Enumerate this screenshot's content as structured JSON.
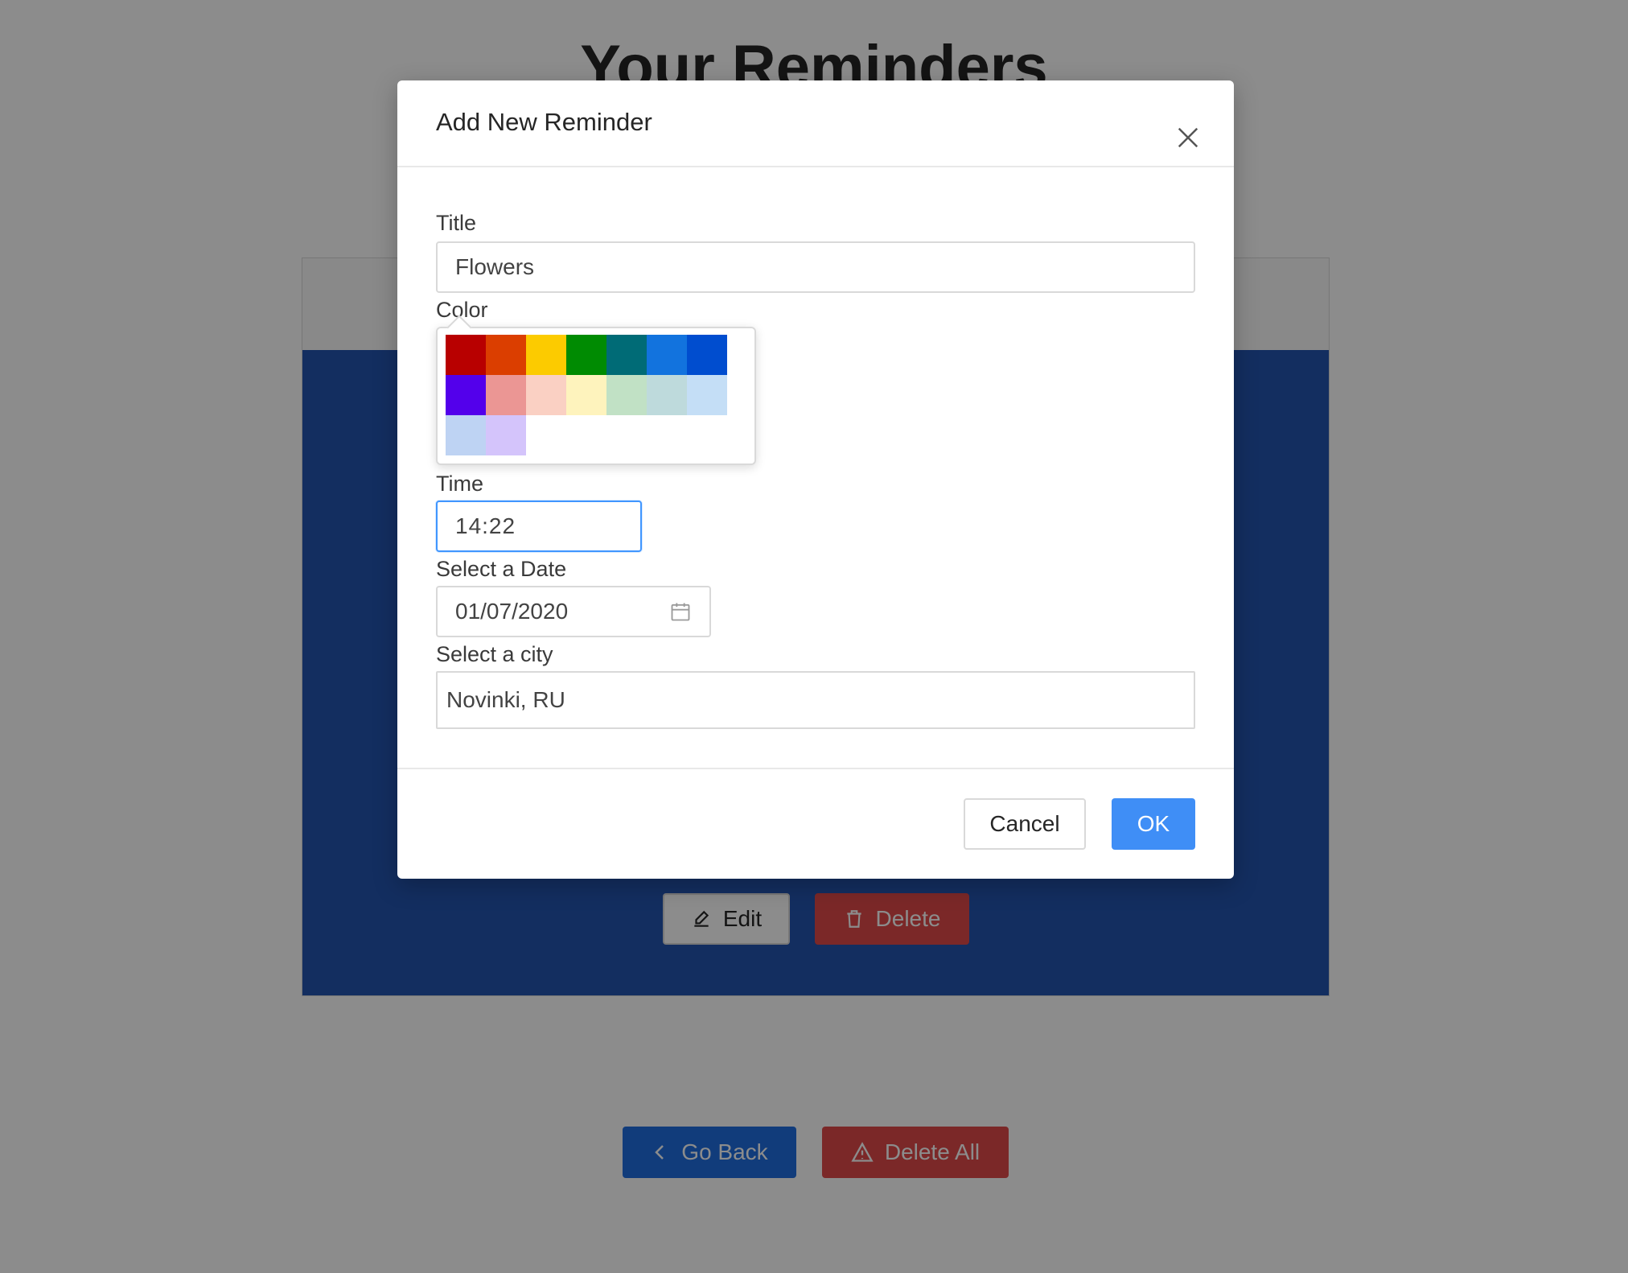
{
  "page": {
    "title": "Your Reminders"
  },
  "reminder_card": {
    "edit_label": "Edit",
    "delete_label": "Delete",
    "color": "#2454b0"
  },
  "actions": {
    "go_back_label": "Go Back",
    "delete_all_label": "Delete All"
  },
  "modal": {
    "title": "Add New Reminder",
    "fields": {
      "title_label": "Title",
      "title_value": "Flowers",
      "color_label": "Color",
      "time_label": "Time",
      "time_value": "14:22",
      "date_label": "Select a Date",
      "date_value": "01/07/2020",
      "city_label": "Select a city",
      "city_value": "Novinki, RU"
    },
    "color_swatches": [
      "#b80000",
      "#db3e00",
      "#fccb00",
      "#008b02",
      "#006b76",
      "#1273de",
      "#004dcf",
      "#5300eb",
      "#eb9694",
      "#fad0c3",
      "#fef3bd",
      "#c1e1c5",
      "#bedadc",
      "#c4def6",
      "#bed3f3",
      "#d4c4fb"
    ],
    "cancel_label": "Cancel",
    "ok_label": "OK"
  },
  "icons": {
    "close": "close-icon",
    "calendar": "calendar-icon",
    "edit": "edit-icon",
    "delete": "trash-icon",
    "back": "chevron-left-icon",
    "warning": "warning-icon"
  }
}
